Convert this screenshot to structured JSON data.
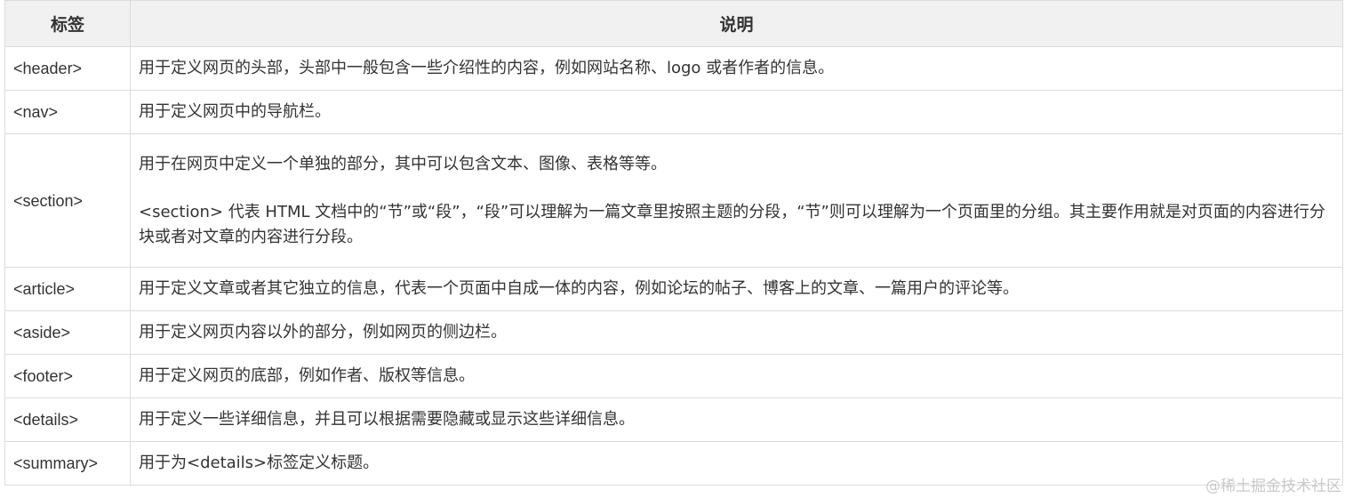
{
  "table": {
    "headers": [
      "标签",
      "说明"
    ],
    "rows": [
      {
        "tag": "<header>",
        "desc": [
          "用于定义网页的头部，头部中一般包含一些介绍性的内容，例如网站名称、logo 或者作者的信息。"
        ]
      },
      {
        "tag": "<nav>",
        "desc": [
          "用于定义网页中的导航栏。"
        ]
      },
      {
        "tag": "<section>",
        "desc": [
          "用于在网页中定义一个单独的部分，其中可以包含文本、图像、表格等等。",
          "<section> 代表 HTML 文档中的“节”或“段”，“段”可以理解为一篇文章里按照主题的分段，“节”则可以理解为一个页面里的分组。其主要作用就是对页面的内容进行分块或者对文章的内容进行分段。"
        ]
      },
      {
        "tag": "<article>",
        "desc": [
          "用于定义文章或者其它独立的信息，代表一个页面中自成一体的内容，例如论坛的帖子、博客上的文章、一篇用户的评论等。"
        ]
      },
      {
        "tag": "<aside>",
        "desc": [
          "用于定义网页内容以外的部分，例如网页的侧边栏。"
        ]
      },
      {
        "tag": "<footer>",
        "desc": [
          "用于定义网页的底部，例如作者、版权等信息。"
        ]
      },
      {
        "tag": "<details>",
        "desc": [
          "用于定义一些详细信息，并且可以根据需要隐藏或显示这些详细信息。"
        ]
      },
      {
        "tag": "<summary>",
        "desc": [
          "用于为<details>标签定义标题。"
        ]
      }
    ]
  },
  "watermark": "@稀土掘金技术社区",
  "colors": {
    "header_bg": "#f1f1f1",
    "border": "#dcdcdc",
    "text": "#333333",
    "watermark": "#c9c9c9"
  }
}
